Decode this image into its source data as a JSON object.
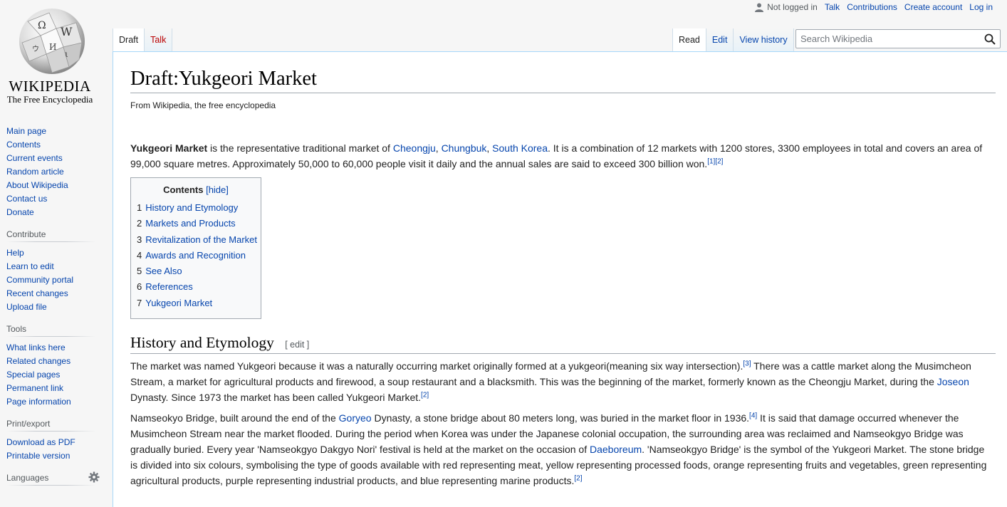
{
  "logo": {
    "wordmark": "WIKIPEDIA",
    "tagline": "The Free Encyclopedia"
  },
  "personal": {
    "status": "Not logged in",
    "items": [
      "Talk",
      "Contributions",
      "Create account",
      "Log in"
    ]
  },
  "tabs": {
    "left": [
      "Draft",
      "Talk"
    ],
    "right": [
      "Read",
      "Edit",
      "View history"
    ]
  },
  "search": {
    "placeholder": "Search Wikipedia"
  },
  "sidebar": {
    "main": [
      "Main page",
      "Contents",
      "Current events",
      "Random article",
      "About Wikipedia",
      "Contact us",
      "Donate"
    ],
    "contribute": {
      "heading": "Contribute",
      "items": [
        "Help",
        "Learn to edit",
        "Community portal",
        "Recent changes",
        "Upload file"
      ]
    },
    "tools": {
      "heading": "Tools",
      "items": [
        "What links here",
        "Related changes",
        "Special pages",
        "Permanent link",
        "Page information"
      ]
    },
    "print": {
      "heading": "Print/export",
      "items": [
        "Download as PDF",
        "Printable version"
      ]
    },
    "languages": {
      "heading": "Languages"
    }
  },
  "article": {
    "title": "Draft:Yukgeori Market",
    "tagline": "From Wikipedia, the free encyclopedia",
    "lead": {
      "bold": "Yukgeori Market",
      "t1": " is the representative traditional market of ",
      "link1": "Cheongju",
      "sep1": ", ",
      "link2": "Chungbuk",
      "sep2": ", ",
      "link3": "South Korea",
      "t2": ". It is a combination of 12 markets with 1200 stores, 3300 employees in total and covers an area of 99,000 square metres. Approximately 50,000 to 60,000 people visit it daily and the annual sales are said to exceed 300 billion won.",
      "ref1": "[1]",
      "ref2": "[2]"
    },
    "toc": {
      "title": "Contents",
      "hide": "[hide]",
      "items": [
        {
          "num": "1",
          "label": "History and Etymology"
        },
        {
          "num": "2",
          "label": "Markets and Products"
        },
        {
          "num": "3",
          "label": "Revitalization of the Market"
        },
        {
          "num": "4",
          "label": "Awards and Recognition"
        },
        {
          "num": "5",
          "label": "See Also"
        },
        {
          "num": "6",
          "label": "References"
        },
        {
          "num": "7",
          "label": "Yukgeori Market"
        }
      ]
    },
    "section1": {
      "heading": "History and Etymology",
      "edit": "[ edit ]",
      "p1": {
        "t1": "The market was named Yukgeori because it was a naturally occurring market originally formed at a yukgeori(meaning six way intersection).",
        "ref1": "[3]",
        "t2": " There was a cattle market along the Musimcheon Stream, a market for agricultural products and firewood, a soup restaurant and a blacksmith. This was the beginning of the market, formerly known as the Cheongju Market, during the ",
        "link1": "Joseon",
        "t3": " Dynasty. Since 1973 the market has been called Yukgeori Market.",
        "ref2": "[2]"
      },
      "p2": {
        "t1": "Namseokyo Bridge, built around the end of the ",
        "link1": "Goryeo",
        "t2": " Dynasty, a stone bridge about 80 meters long, was buried in the market floor in 1936.",
        "ref1": "[4]",
        "t3": " It is said that damage occurred whenever the Musimcheon Stream near the market flooded. During the period when Korea was under the Japanese colonial occupation, the surrounding area was reclaimed and Namseokgyo Bridge was gradually buried. Every year 'Namseokgyo Dakgyo Nori' festival is held at the market on the occasion of ",
        "link2": "Daeboreum",
        "t4": ". 'Namseokgyo Bridge' is the symbol of the Yukgeori Market. The stone bridge is divided into six colours, symbolising the type of goods available with red representing meat, yellow representing processed foods, orange representing fruits and vegetables, green representing agricultural products, purple representing industrial products, and blue representing marine products.",
        "ref2": "[2]"
      }
    }
  },
  "colors": {
    "link": "#0645ad",
    "new_link": "#ba0000",
    "border": "#a7d7f9"
  }
}
